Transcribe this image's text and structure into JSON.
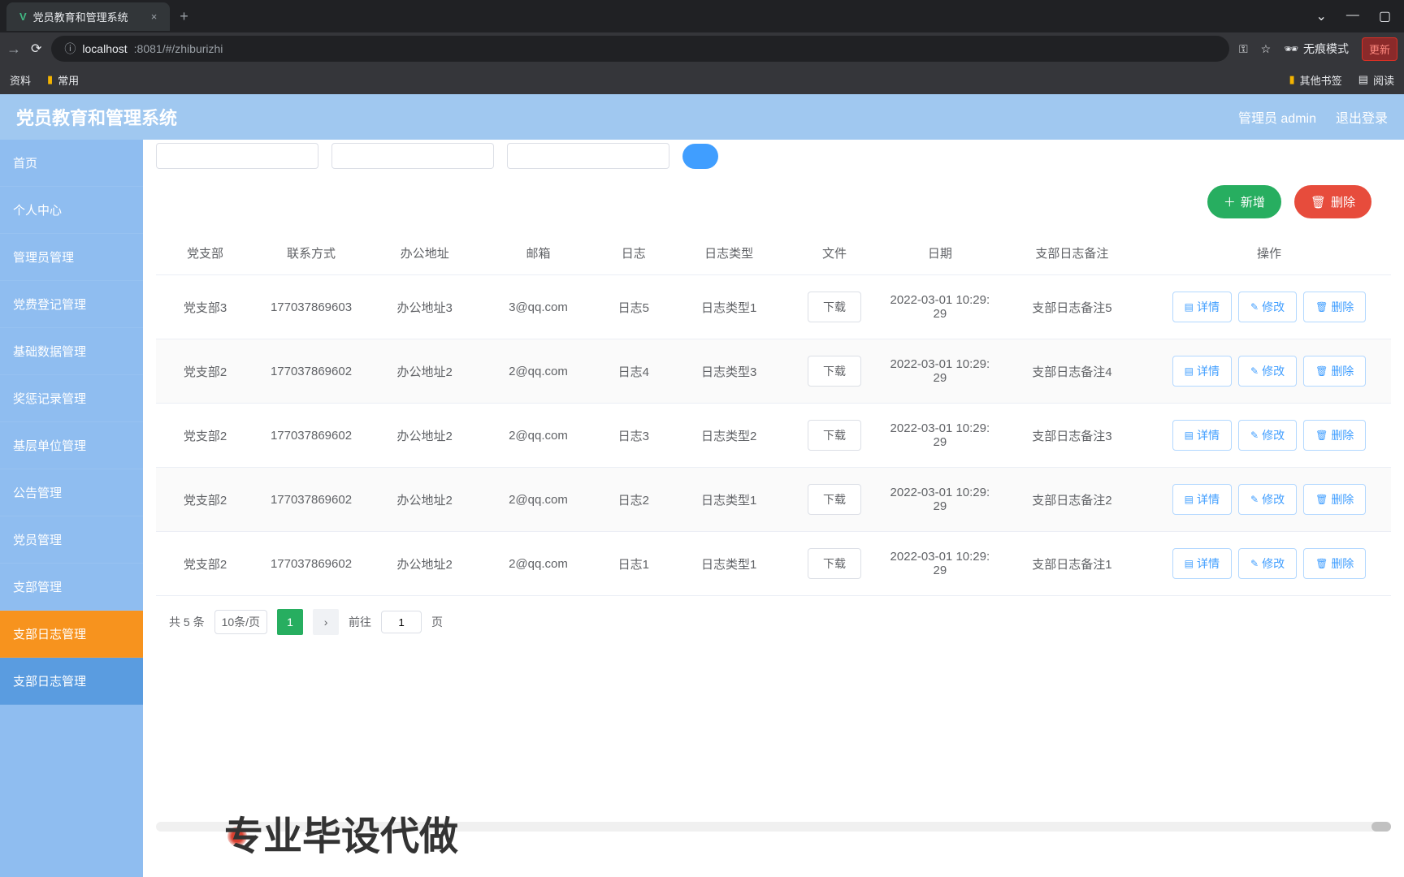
{
  "browser": {
    "tab_title": "党员教育和管理系统",
    "url_host": "localhost",
    "url_path": ":8081/#/zhiburizhi",
    "bookmarks": {
      "b1": "资料",
      "b2": "常用",
      "other": "其他书签",
      "reading": "阅读"
    },
    "incognito": "无痕模式",
    "update": "更新"
  },
  "header": {
    "title": "党员教育和管理系统",
    "user": "管理员 admin",
    "logout": "退出登录"
  },
  "sidebar": {
    "items": [
      "首页",
      "个人中心",
      "管理员管理",
      "党费登记管理",
      "基础数据管理",
      "奖惩记录管理",
      "基层单位管理",
      "公告管理",
      "党员管理",
      "支部管理",
      "支部日志管理",
      "支部日志管理"
    ],
    "active_index": 10
  },
  "actions": {
    "add": "新增",
    "delete": "删除"
  },
  "table": {
    "headers": [
      "党支部",
      "联系方式",
      "办公地址",
      "邮箱",
      "日志",
      "日志类型",
      "文件",
      "日期",
      "支部日志备注",
      "操作"
    ],
    "download_label": "下载",
    "ops": {
      "detail": "详情",
      "edit": "修改",
      "del": "删除"
    },
    "rows": [
      {
        "branch": "党支部3",
        "contact": "177037869603",
        "addr": "办公地址3",
        "email": "3@qq.com",
        "log": "日志5",
        "type": "日志类型1",
        "date": "2022-03-01 10:29:29",
        "remark": "支部日志备注5"
      },
      {
        "branch": "党支部2",
        "contact": "177037869602",
        "addr": "办公地址2",
        "email": "2@qq.com",
        "log": "日志4",
        "type": "日志类型3",
        "date": "2022-03-01 10:29:29",
        "remark": "支部日志备注4"
      },
      {
        "branch": "党支部2",
        "contact": "177037869602",
        "addr": "办公地址2",
        "email": "2@qq.com",
        "log": "日志3",
        "type": "日志类型2",
        "date": "2022-03-01 10:29:29",
        "remark": "支部日志备注3"
      },
      {
        "branch": "党支部2",
        "contact": "177037869602",
        "addr": "办公地址2",
        "email": "2@qq.com",
        "log": "日志2",
        "type": "日志类型1",
        "date": "2022-03-01 10:29:29",
        "remark": "支部日志备注2"
      },
      {
        "branch": "党支部2",
        "contact": "177037869602",
        "addr": "办公地址2",
        "email": "2@qq.com",
        "log": "日志1",
        "type": "日志类型1",
        "date": "2022-03-01 10:29:29",
        "remark": "支部日志备注1"
      }
    ]
  },
  "pagination": {
    "total": "共 5 条",
    "size": "10条/页",
    "current": "1",
    "goto": "前往",
    "page_input": "1",
    "page_suffix": "页"
  },
  "watermark": "专业毕设代做"
}
